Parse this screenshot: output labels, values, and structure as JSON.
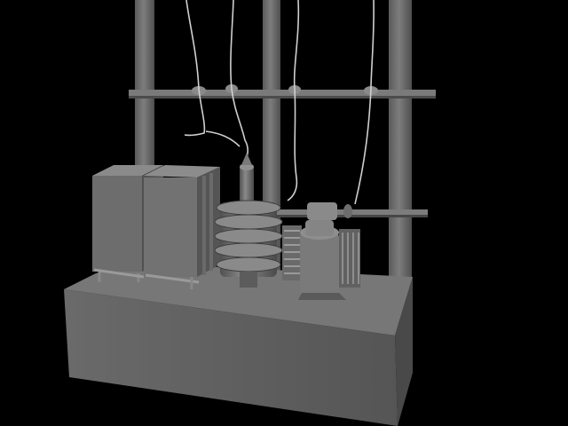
{
  "scene": {
    "subject": "substation-equipment-3d-render",
    "background_color": "#000000",
    "palette": {
      "light": "#8c8c8c",
      "mid": "#6e6e6e",
      "dark": "#4a4a4a",
      "shadow": "#333333",
      "wire": "#cfcfcf"
    }
  }
}
